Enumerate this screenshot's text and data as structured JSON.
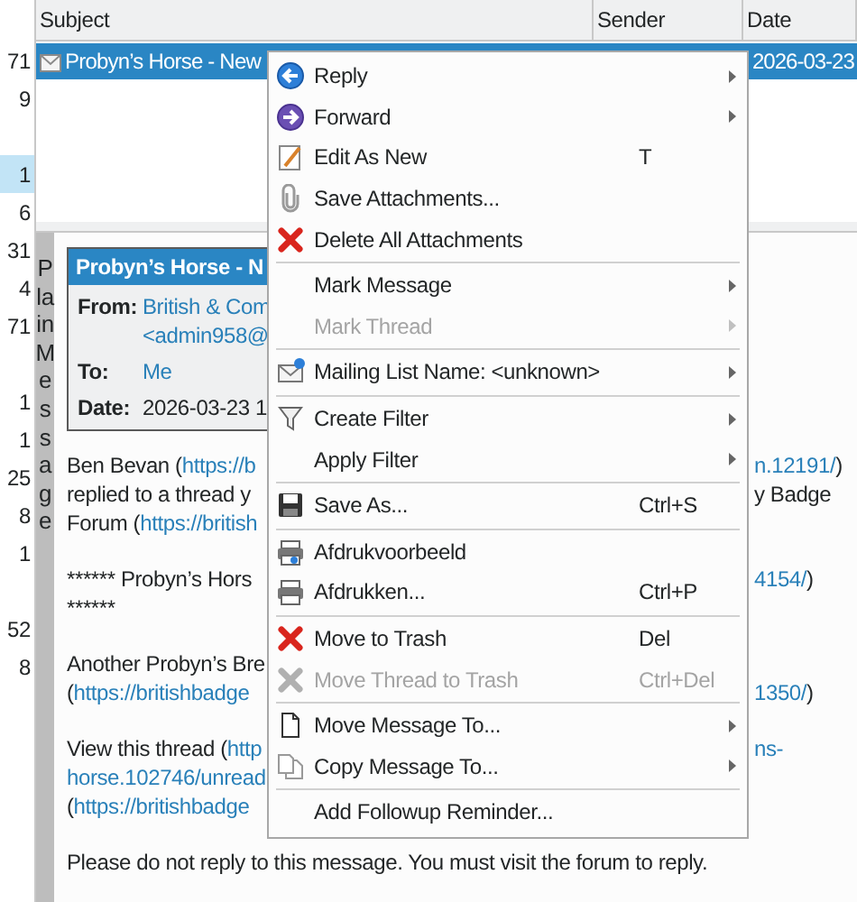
{
  "folder_counts": [
    {
      "kind": "count",
      "text": "71",
      "selected": false
    },
    {
      "kind": "count",
      "text": "9",
      "selected": false
    },
    {
      "kind": "blank",
      "selected": false
    },
    {
      "kind": "count",
      "text": "1",
      "selected": true
    },
    {
      "kind": "count",
      "text": "6",
      "selected": false
    },
    {
      "kind": "count",
      "text": "31",
      "selected": false
    },
    {
      "kind": "count",
      "text": "4",
      "selected": false
    },
    {
      "kind": "count",
      "text": "71",
      "selected": false
    },
    {
      "kind": "blank",
      "selected": false
    },
    {
      "kind": "count",
      "text": "1",
      "selected": false
    },
    {
      "kind": "count",
      "text": "1",
      "selected": false
    },
    {
      "kind": "count",
      "text": "25",
      "selected": false
    },
    {
      "kind": "count",
      "text": "8",
      "selected": false
    },
    {
      "kind": "count",
      "text": "1",
      "selected": false
    },
    {
      "kind": "blank",
      "selected": false
    },
    {
      "kind": "count",
      "text": "52",
      "selected": false
    },
    {
      "kind": "count",
      "text": "8",
      "selected": false
    }
  ],
  "message_list": {
    "columns": [
      "Subject",
      "Sender",
      "Date"
    ],
    "rows": [
      {
        "subject": "Probyn’s Horse - New",
        "date": "2026-03-23",
        "selected": true
      }
    ]
  },
  "message_view": {
    "mode_tab": "Plain Message",
    "header": {
      "title": "Probyn’s Horse - N",
      "from_label": "From:",
      "from": "British & Com",
      "from_address": "<admin958@",
      "to_label": "To:",
      "to": "Me",
      "date_label": "Date:",
      "date": "2026-03-23 1"
    },
    "paragraphs": [
      [
        {
          "left": [
            {
              "text": "Ben Bevan (",
              "kind": "text"
            },
            {
              "text": "https://b",
              "kind": "link"
            }
          ],
          "right": [
            {
              "text": "n.12191/",
              "kind": "link"
            },
            {
              "text": ")",
              "kind": "text"
            }
          ]
        },
        {
          "left": [
            {
              "text": "replied to a thread y",
              "kind": "text"
            }
          ],
          "right": [
            {
              "text": "y Badge",
              "kind": "text"
            }
          ]
        },
        {
          "left": [
            {
              "text": "Forum (",
              "kind": "text"
            },
            {
              "text": "https://british",
              "kind": "link"
            }
          ]
        }
      ],
      [
        {
          "left": [
            {
              "text": "****** Probyn’s Hors",
              "kind": "text"
            }
          ],
          "right": [
            {
              "text": "4154/",
              "kind": "link"
            },
            {
              "text": ")",
              "kind": "text"
            }
          ]
        },
        {
          "left": [
            {
              "text": "******",
              "kind": "text"
            }
          ]
        }
      ],
      [
        {
          "left": [
            {
              "text": "Another Probyn’s Bre",
              "kind": "text"
            }
          ]
        },
        {
          "left": [
            {
              "text": "(",
              "kind": "text"
            },
            {
              "text": "https://britishbadge",
              "kind": "link"
            }
          ],
          "right": [
            {
              "text": "1350/",
              "kind": "link"
            },
            {
              "text": ")",
              "kind": "text"
            }
          ]
        }
      ],
      [
        {
          "left": [
            {
              "text": "View this thread (",
              "kind": "text"
            },
            {
              "text": "http",
              "kind": "link"
            }
          ],
          "right": [
            {
              "text": "ns-",
              "kind": "link"
            }
          ]
        },
        {
          "left": [
            {
              "text": "horse.102746/unread",
              "kind": "link"
            }
          ]
        },
        {
          "left": [
            {
              "text": "(",
              "kind": "text"
            },
            {
              "text": "https://britishbadge",
              "kind": "link"
            }
          ]
        }
      ],
      [
        {
          "left": [
            {
              "text": "Please do not reply to this message. You must visit the forum to reply.",
              "kind": "text"
            }
          ]
        }
      ]
    ]
  },
  "context_menu": [
    [
      {
        "label": "Reply",
        "kind": "reply",
        "submenu": true,
        "disabled": false
      },
      {
        "label": "Forward",
        "kind": "forward",
        "submenu": true,
        "disabled": false
      },
      {
        "label": "Edit As New",
        "kind": "edit",
        "shortcut": "T",
        "submenu": false,
        "disabled": false
      },
      {
        "label": "Save Attachments...",
        "kind": "attach",
        "submenu": false,
        "disabled": false
      },
      {
        "label": "Delete All Attachments",
        "kind": "x",
        "submenu": false,
        "disabled": false
      }
    ],
    [
      {
        "label": "Mark Message",
        "kind": "plain",
        "submenu": true,
        "disabled": false
      },
      {
        "label": "Mark Thread",
        "kind": "plain",
        "submenu": true,
        "disabled": true
      }
    ],
    [
      {
        "label": "Mailing List Name: <unknown>",
        "kind": "mail",
        "submenu": true,
        "disabled": false
      }
    ],
    [
      {
        "label": "Create Filter",
        "kind": "filter",
        "submenu": true,
        "disabled": false
      },
      {
        "label": "Apply Filter",
        "kind": "plain",
        "submenu": true,
        "disabled": false
      }
    ],
    [
      {
        "label": "Save As...",
        "kind": "save",
        "shortcut": "Ctrl+S",
        "submenu": false,
        "disabled": false
      }
    ],
    [
      {
        "label": "Afdrukvoorbeeld",
        "kind": "preview",
        "submenu": false,
        "disabled": false
      },
      {
        "label": "Afdrukken...",
        "kind": "print",
        "shortcut": "Ctrl+P",
        "submenu": false,
        "disabled": false
      }
    ],
    [
      {
        "label": "Move to Trash",
        "kind": "x",
        "shortcut": "Del",
        "submenu": false,
        "disabled": false
      },
      {
        "label": "Move Thread to Trash",
        "kind": "x",
        "shortcut": "Ctrl+Del",
        "submenu": false,
        "disabled": true
      }
    ],
    [
      {
        "label": "Move Message To...",
        "kind": "page",
        "submenu": true,
        "disabled": false
      },
      {
        "label": "Copy Message To...",
        "kind": "pages",
        "submenu": true,
        "disabled": false
      }
    ],
    [
      {
        "label": "Add Followup Reminder...",
        "kind": "plain",
        "submenu": false,
        "disabled": false
      }
    ]
  ]
}
